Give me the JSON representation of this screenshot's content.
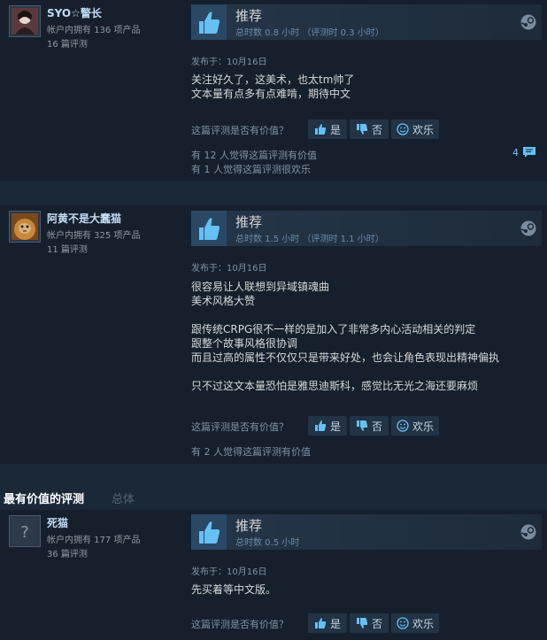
{
  "common": {
    "helpful_question": "这篇评测是否有价值？",
    "yes_label": "是",
    "no_label": "否",
    "funny_label": "欢乐"
  },
  "reviews": [
    {
      "author": {
        "name": "SYO☆警长",
        "products": "帐户内拥有 136 项产品",
        "reviews": "16 篇评测"
      },
      "verdict": "推荐",
      "hours": "总时数 0.8 小时  （评测时 0.3 小时）",
      "posted": "发布于：10月16日",
      "body": [
        "关注好久了，这美术，也太tm帅了",
        "文本量有点多有点难啃，期待中文"
      ],
      "stats": [
        "有 12 人觉得这篇评测有价值",
        "有 1 人觉得这篇评测很欢乐"
      ],
      "comment_count": "4"
    },
    {
      "author": {
        "name": "阿黄不是大蠢猫",
        "products": "帐户内拥有 325 项产品",
        "reviews": "11 篇评测"
      },
      "verdict": "推荐",
      "hours": "总时数 1.5 小时  （评测时 1.1 小时）",
      "posted": "发布于：10月16日",
      "body": [
        "很容易让人联想到异域镇魂曲",
        "美术风格大赞",
        "",
        "跟传统CRPG很不一样的是加入了非常多内心活动相关的判定",
        "跟整个故事风格很协调",
        "而且过高的属性不仅仅只是带来好处，也会让角色表现出精神偏执",
        "",
        "只不过这文本量恐怕是雅思迪斯科，感觉比无光之海还要麻烦"
      ],
      "stats": [
        "有 2 人觉得这篇评测有价值"
      ]
    },
    {
      "author": {
        "name": "死猫",
        "products": "帐户内拥有 177 项产品",
        "reviews": "36 篇评测"
      },
      "verdict": "推荐",
      "hours": "总时数 0.5 小时",
      "posted": "发布于：10月16日",
      "body": [
        "先买着等中文版。"
      ]
    }
  ],
  "section": {
    "title": "最有价值的评测",
    "sub": "总体"
  }
}
